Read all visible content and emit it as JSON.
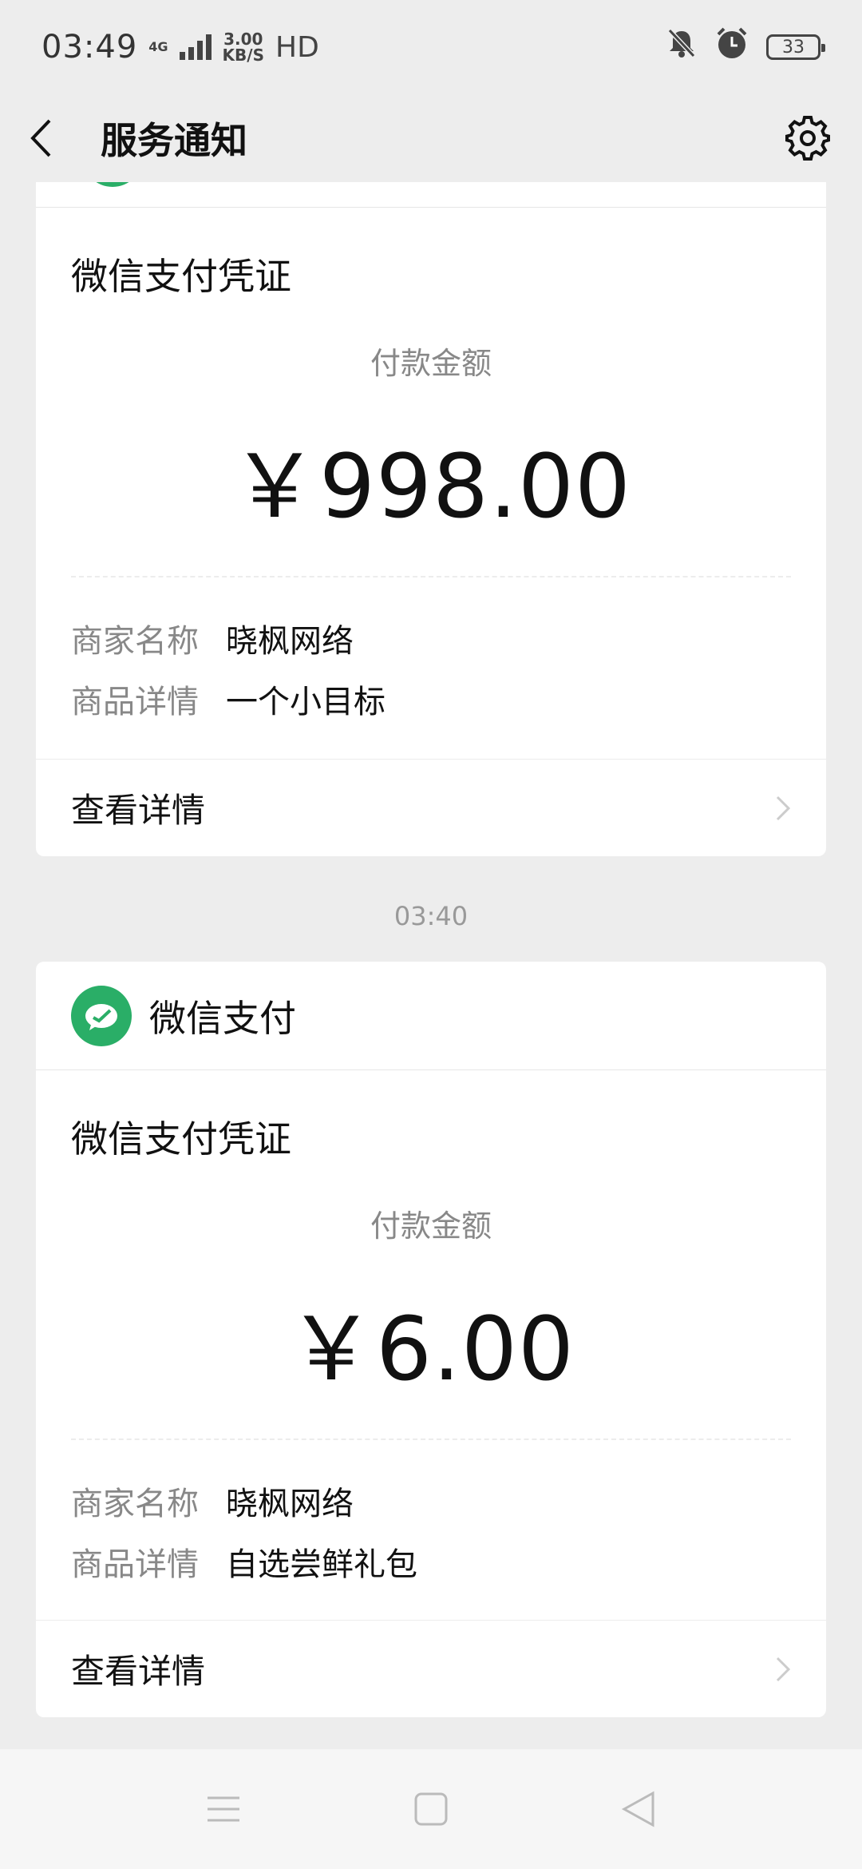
{
  "status_bar": {
    "time": "03:49",
    "network": "4G",
    "speed_value": "3.00",
    "speed_unit": "KB/S",
    "hd": "HD",
    "battery": "33"
  },
  "nav": {
    "title": "服务通知"
  },
  "messages": [
    {
      "app_name": "",
      "title": "微信支付凭证",
      "amount_label": "付款金额",
      "amount": "￥998.00",
      "merchant_key": "商家名称",
      "merchant_value": "晓枫网络",
      "product_key": "商品详情",
      "product_value": "一个小目标",
      "details_label": "查看详情"
    },
    {
      "timestamp": "03:40",
      "app_name": "微信支付",
      "title": "微信支付凭证",
      "amount_label": "付款金额",
      "amount": "￥6.00",
      "merchant_key": "商家名称",
      "merchant_value": "晓枫网络",
      "product_key": "商品详情",
      "product_value": "自选尝鲜礼包",
      "details_label": "查看详情"
    }
  ],
  "colors": {
    "wechat_pay_green": "#2aae67",
    "background": "#ededed"
  }
}
